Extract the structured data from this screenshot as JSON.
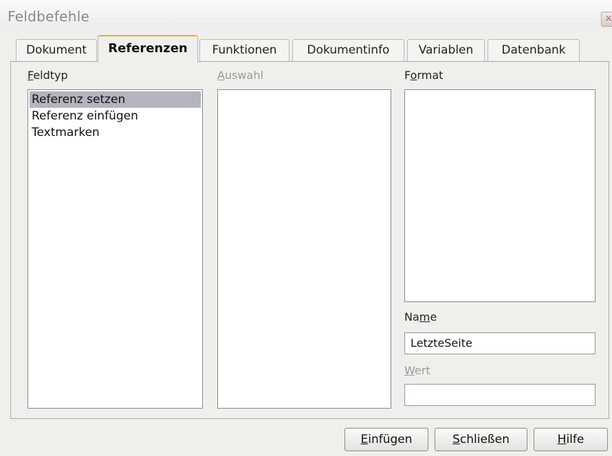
{
  "window": {
    "title": "Feldbefehle",
    "close_glyph": "×"
  },
  "tabs": [
    {
      "label": "Dokument",
      "active": false
    },
    {
      "label": "Referenzen",
      "active": true
    },
    {
      "label": "Funktionen",
      "active": false
    },
    {
      "label": "Dokumentinfo",
      "active": false
    },
    {
      "label": "Variablen",
      "active": false
    },
    {
      "label": "Datenbank",
      "active": false
    }
  ],
  "feldtyp": {
    "label_first": "F",
    "label_rest": "eldtyp",
    "items": [
      "Referenz setzen",
      "Referenz einfügen",
      "Textmarken"
    ],
    "selected": "Referenz setzen"
  },
  "auswahl": {
    "label_first": "A",
    "label_rest": "uswahl",
    "disabled": true
  },
  "format": {
    "label_first": "F",
    "label_u": "o",
    "label_rest": "rmat"
  },
  "name": {
    "label_pre": "Na",
    "label_u": "m",
    "label_post": "e",
    "value": "LetzteSeite"
  },
  "wert": {
    "label_first": "W",
    "label_rest": "ert",
    "value": "",
    "disabled": true
  },
  "buttons": {
    "insert": {
      "u": "E",
      "rest": "infügen"
    },
    "close": {
      "u": "S",
      "rest": "chließen"
    },
    "help": {
      "u": "H",
      "rest": "ilfe"
    }
  },
  "colors": {
    "active_tab_accent": "#e6a84a",
    "selection": "#b3b4bd"
  }
}
